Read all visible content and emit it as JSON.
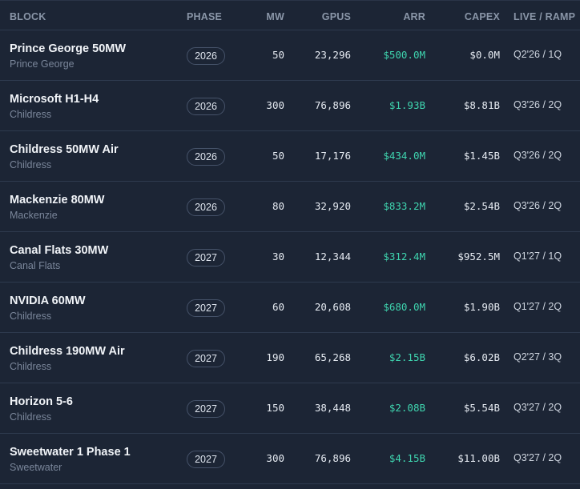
{
  "columns": {
    "block": "BLOCK",
    "phase": "PHASE",
    "mw": "MW",
    "gpus": "GPUS",
    "arr": "ARR",
    "capex": "CAPEX",
    "live_ramp": "LIVE / RAMP"
  },
  "rows": [
    {
      "name": "Prince George 50MW",
      "location": "Prince George",
      "phase": "2026",
      "mw": "50",
      "gpus": "23,296",
      "arr": "$500.0M",
      "capex": "$0.0M",
      "ramp": "Q2'26 / 1Q"
    },
    {
      "name": "Microsoft H1-H4",
      "location": "Childress",
      "phase": "2026",
      "mw": "300",
      "gpus": "76,896",
      "arr": "$1.93B",
      "capex": "$8.81B",
      "ramp": "Q3'26 / 2Q"
    },
    {
      "name": "Childress 50MW Air",
      "location": "Childress",
      "phase": "2026",
      "mw": "50",
      "gpus": "17,176",
      "arr": "$434.0M",
      "capex": "$1.45B",
      "ramp": "Q3'26 / 2Q"
    },
    {
      "name": "Mackenzie 80MW",
      "location": "Mackenzie",
      "phase": "2026",
      "mw": "80",
      "gpus": "32,920",
      "arr": "$833.2M",
      "capex": "$2.54B",
      "ramp": "Q3'26 / 2Q"
    },
    {
      "name": "Canal Flats 30MW",
      "location": "Canal Flats",
      "phase": "2027",
      "mw": "30",
      "gpus": "12,344",
      "arr": "$312.4M",
      "capex": "$952.5M",
      "ramp": "Q1'27 / 1Q"
    },
    {
      "name": "NVIDIA 60MW",
      "location": "Childress",
      "phase": "2027",
      "mw": "60",
      "gpus": "20,608",
      "arr": "$680.0M",
      "capex": "$1.90B",
      "ramp": "Q1'27 / 2Q"
    },
    {
      "name": "Childress 190MW Air",
      "location": "Childress",
      "phase": "2027",
      "mw": "190",
      "gpus": "65,268",
      "arr": "$2.15B",
      "capex": "$6.02B",
      "ramp": "Q2'27 / 3Q"
    },
    {
      "name": "Horizon 5-6",
      "location": "Childress",
      "phase": "2027",
      "mw": "150",
      "gpus": "38,448",
      "arr": "$2.08B",
      "capex": "$5.54B",
      "ramp": "Q3'27 / 2Q"
    },
    {
      "name": "Sweetwater 1 Phase 1",
      "location": "Sweetwater",
      "phase": "2027",
      "mw": "300",
      "gpus": "76,896",
      "arr": "$4.15B",
      "capex": "$11.00B",
      "ramp": "Q3'27 / 2Q"
    }
  ],
  "colors": {
    "background": "#1c2535",
    "arr_accent": "#3fd6b0",
    "header_text": "#8a96a8",
    "divider": "#2e3a4e"
  }
}
